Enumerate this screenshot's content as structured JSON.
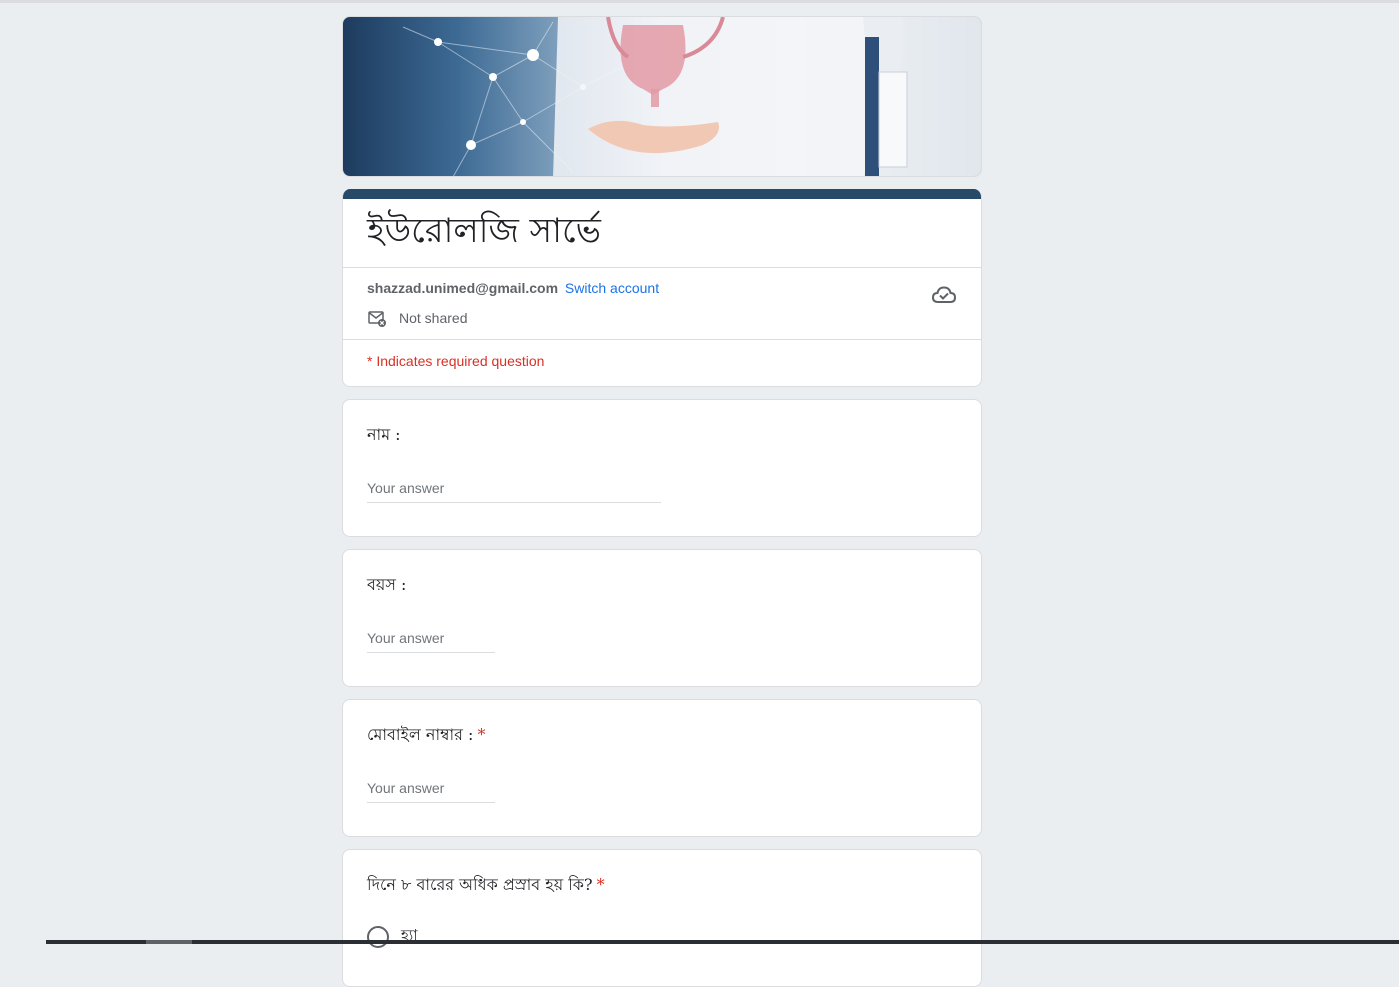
{
  "form": {
    "title": "ইউরোলজি সার্ভে",
    "account_email": "shazzad.unimed@gmail.com",
    "switch_account_label": "Switch account",
    "sharing_status": "Not shared",
    "required_note": "* Indicates required question"
  },
  "questions": [
    {
      "label": "নাম :",
      "required": false,
      "placeholder": "Your answer"
    },
    {
      "label": "বয়স :",
      "required": false,
      "placeholder": "Your answer"
    },
    {
      "label": "মোবাইল নাম্বার :",
      "required": true,
      "required_mark": "*",
      "placeholder": "Your answer"
    },
    {
      "label": "দিনে ৮ বারের অধিক প্রস্রাব হয় কি?",
      "required": true,
      "required_mark": "*",
      "options": [
        "হ্যা"
      ]
    }
  ],
  "icons": {
    "mail_status": "mail-not-shared-icon",
    "cloud_save": "cloud-check-icon"
  },
  "colors": {
    "page_background": "#ebeef1",
    "title_accent": "#264a68",
    "link": "#1a73e8",
    "required": "#d93025"
  }
}
